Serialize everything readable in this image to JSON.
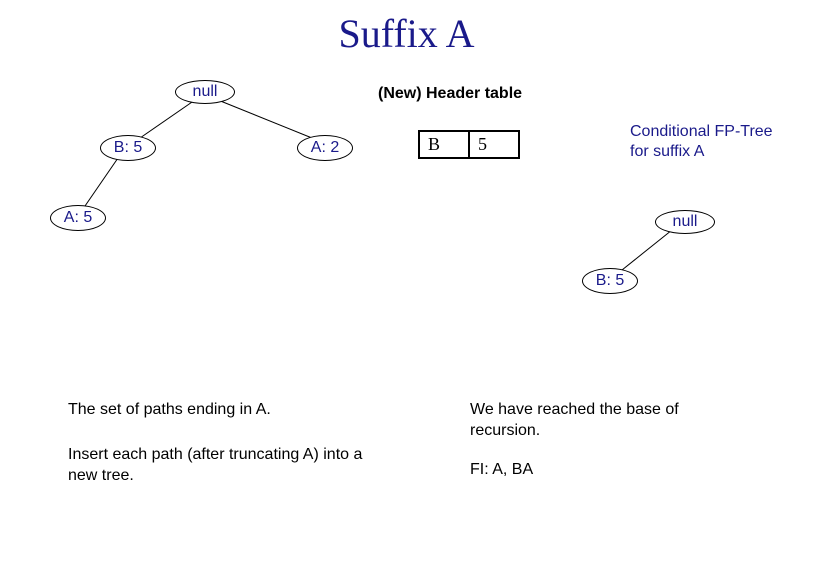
{
  "title": "Suffix A",
  "left_tree": {
    "root": "null",
    "n_b5": "B: 5",
    "n_a2": "A: 2",
    "n_a5": "A: 5"
  },
  "header_table": {
    "title": "(New) Header table",
    "item": "B",
    "count": "5"
  },
  "right_caption": "Conditional FP-Tree for suffix A",
  "right_tree": {
    "root": "null",
    "n_b5": "B: 5"
  },
  "left_text": {
    "p1": "The set of paths ending in A.",
    "p2": "Insert each path (after truncating A) into a new tree."
  },
  "right_text": {
    "p1": "We have reached the base of recursion.",
    "p2": "FI: A, BA"
  }
}
